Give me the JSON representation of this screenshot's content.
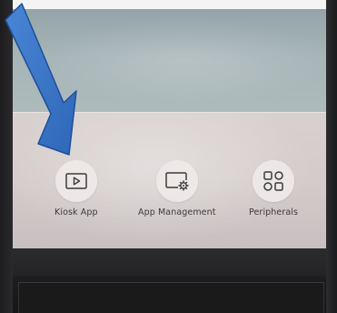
{
  "menu": {
    "items": [
      {
        "label": "Kiosk App",
        "icon": "play-screen-icon"
      },
      {
        "label": "App Management",
        "icon": "screen-gear-icon"
      },
      {
        "label": "Peripherals",
        "icon": "shapes-icon"
      }
    ]
  },
  "annotation": {
    "arrow_color": "#3b78c9",
    "arrow_outline": "#1d4f9a"
  }
}
